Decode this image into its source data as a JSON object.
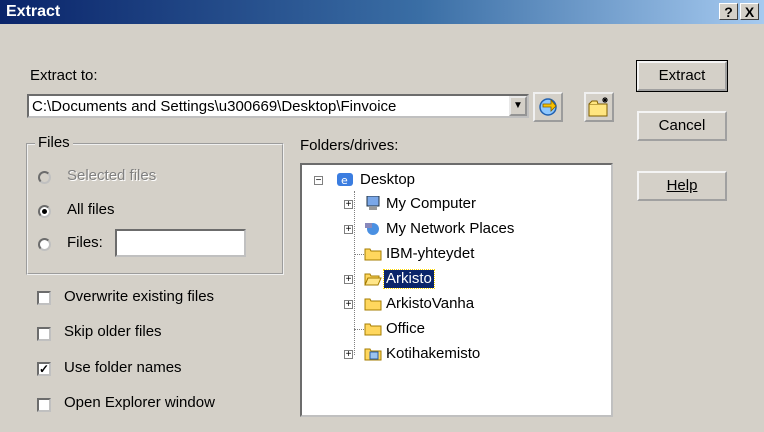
{
  "window": {
    "title": "Extract",
    "help_glyph": "?",
    "close_glyph": "X"
  },
  "extract_to": {
    "label": "Extract to:",
    "path": "C:\\Documents and Settings\\u300669\\Desktop\\Finvoice"
  },
  "buttons": {
    "extract": "Extract",
    "cancel": "Cancel",
    "help": "Help"
  },
  "files_group": {
    "label": "Files",
    "selected_files": "Selected files",
    "all_files": "All files",
    "files": "Files:",
    "files_value": ""
  },
  "options": {
    "overwrite": "Overwrite existing files",
    "skip_older": "Skip older files",
    "use_folder_names": "Use folder names",
    "open_explorer": "Open Explorer window"
  },
  "folders_label": "Folders/drives:",
  "tree": {
    "root": "Desktop",
    "items": [
      "My Computer",
      "My Network Places",
      "IBM-yhteydet",
      "Arkisto",
      "ArkistoVanha",
      "Office",
      "Kotihakemisto"
    ]
  }
}
